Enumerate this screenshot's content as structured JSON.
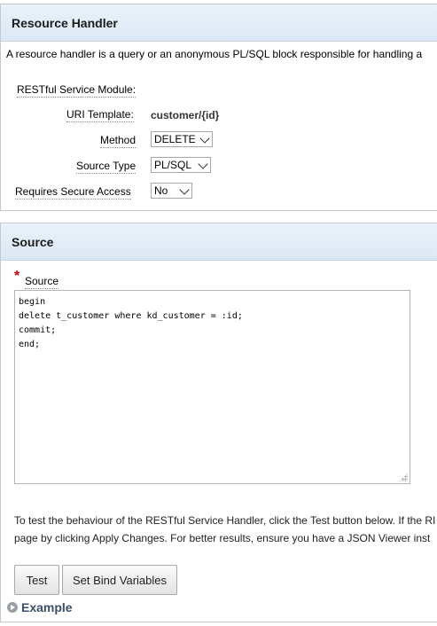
{
  "resource_handler": {
    "title": "Resource Handler",
    "intro": "A resource handler is a query or an anonymous PL/SQL block responsible for handling a",
    "module_label": "RESTful Service Module:",
    "uri_label": "URI Template:",
    "uri_value": "customer/{id}",
    "method_label": "Method",
    "method_value": "DELETE",
    "source_type_label": "Source Type",
    "source_type_value": "PL/SQL",
    "secure_label": "Requires Secure Access",
    "secure_value": "No"
  },
  "source": {
    "title": "Source",
    "required_mark": "*",
    "field_label": "Source",
    "code": "begin\ndelete t_customer where kd_customer = :id;\ncommit;\nend;",
    "help_line1": "To test the behaviour of the RESTful Service Handler, click the Test button below. If the RI",
    "help_line2": "page by clicking Apply Changes. For better results, ensure you have a JSON Viewer inst",
    "test_button": "Test",
    "bind_button": "Set Bind Variables",
    "example_label": "Example"
  }
}
